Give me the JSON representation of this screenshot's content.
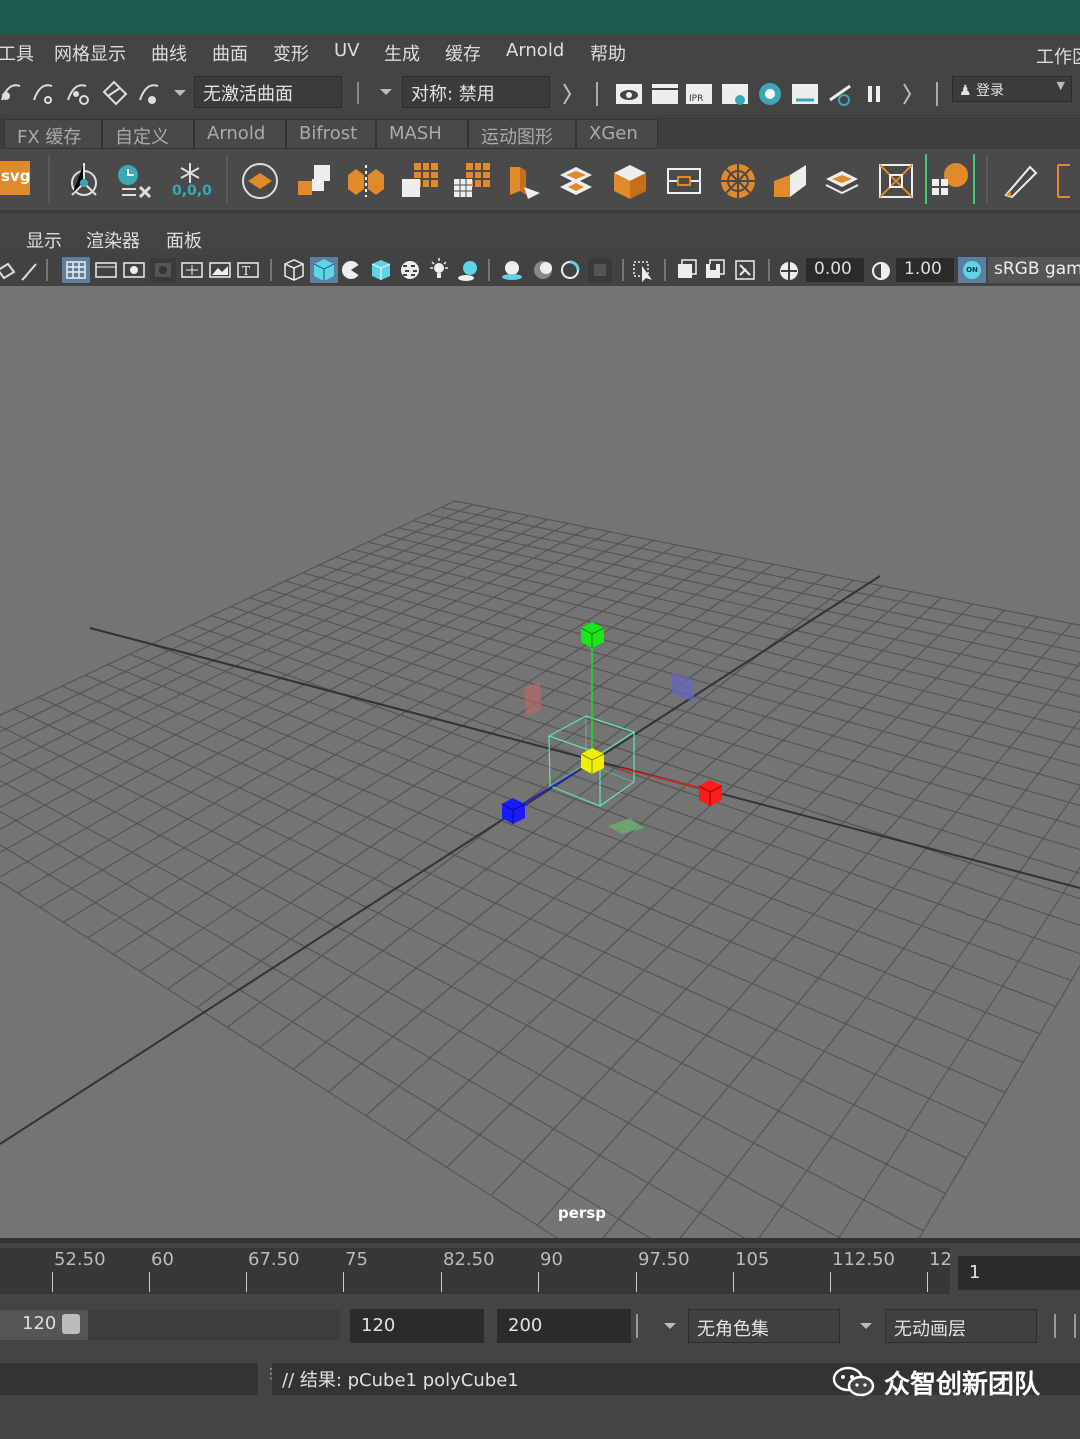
{
  "menubar": {
    "items": [
      "工具",
      "网格显示",
      "曲线",
      "曲面",
      "变形",
      "UV",
      "生成",
      "缓存",
      "Arnold",
      "帮助"
    ],
    "workspace_label": "工作区"
  },
  "status_line": {
    "surface_field": "无激活曲面",
    "symmetry_field": "对称: 禁用",
    "login_label": "登录"
  },
  "shelf_tabs": [
    "FX 缓存",
    "自定义",
    "Arnold",
    "Bifrost",
    "MASH",
    "运动图形",
    "XGen"
  ],
  "shelf": {
    "svg_label": "svg",
    "freeze_value": "0,0,0",
    "icons": [
      "snap-curve-icon",
      "snap-point-icon",
      "snap-view-icon",
      "snap-surface-icon",
      "create-svg-icon",
      "pivot-icon",
      "delete-history-icon",
      "freeze-transforms-icon",
      "poly-sphere-icon",
      "combine-icon",
      "separate-icon",
      "extract-icon",
      "smooth-icon",
      "bevel-icon",
      "bridge-icon",
      "extrude-icon",
      "uv-icon",
      "bounding-box-icon",
      "sphere-wire-icon",
      "cube-split-icon",
      "planar-icon",
      "lattice-icon",
      "soft-select-icon",
      "paint-icon",
      "crease-icon"
    ]
  },
  "panel_menu": [
    "显示",
    "渲染器",
    "面板"
  ],
  "panel_toolbar": {
    "exposure": "0.00",
    "gamma": "1.00",
    "color_space": "sRGB gam",
    "on_badge": "ON"
  },
  "viewport": {
    "camera": "persp",
    "colors": {
      "background": "#747474",
      "grid": "#5a5a5a",
      "x_axis": "#ff1a1a",
      "y_axis": "#1ae61a",
      "z_axis": "#1a1aff",
      "center": "#f0f000",
      "selection": "#5fe8a8"
    }
  },
  "timeline": {
    "ticks": [
      "52.50",
      "60",
      "67.50",
      "75",
      "82.50",
      "90",
      "97.50",
      "105",
      "112.50",
      "12"
    ],
    "current_frame": "1"
  },
  "range": {
    "start_value": "120",
    "end_value": "120",
    "max_value": "200",
    "character_set": "无角色集",
    "anim_layer": "无动画层"
  },
  "command_line": {
    "result": "// 结果: pCube1 polyCube1"
  },
  "watermark": "众智创新团队"
}
